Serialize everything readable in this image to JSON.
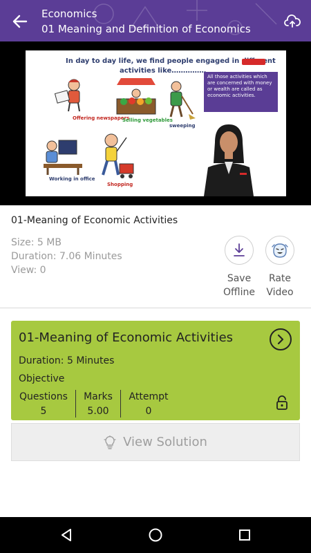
{
  "header": {
    "subject": "Economics",
    "title": "01 Meaning and Definition of Economics",
    "back_icon": "arrow-left-icon",
    "cloud_icon": "cloud-upload-icon",
    "background": "#5b3d96"
  },
  "video": {
    "slide_heading_line1": "In day to day life, we find people engaged in different",
    "slide_heading_line2": "activities  like……………",
    "slide_note": "All those activities which are concerned with money or wealth are called as economic activities.",
    "labels": {
      "newspapers": "Offering newspapers",
      "vegetables": "Selling vegetables",
      "sweeping": "sweeping",
      "office": "Working in office",
      "shopping": "Shopping"
    }
  },
  "lecture": {
    "title": "01-Meaning of Economic Activities",
    "size": "Size: 5 MB",
    "duration": "Duration: 7.06 Minutes",
    "views": "View: 0"
  },
  "actions": {
    "save_offline": [
      "Save",
      "Offline"
    ],
    "rate_video": [
      "Rate",
      "Video"
    ]
  },
  "test_card": {
    "title": "01-Meaning of Economic Activities",
    "duration": "Duration: 5 Minutes",
    "type": "Objective",
    "stats": [
      {
        "label": "Questions",
        "value": "5"
      },
      {
        "label": "Marks",
        "value": "5.00"
      },
      {
        "label": "Attempt",
        "value": "0"
      }
    ],
    "color": "#a7c940"
  },
  "view_solution": {
    "label": "View Solution",
    "icon": "lightbulb-icon"
  },
  "navbar": {
    "back_icon": "nav-back-icon",
    "home_icon": "nav-home-icon",
    "recents_icon": "nav-recents-icon"
  }
}
